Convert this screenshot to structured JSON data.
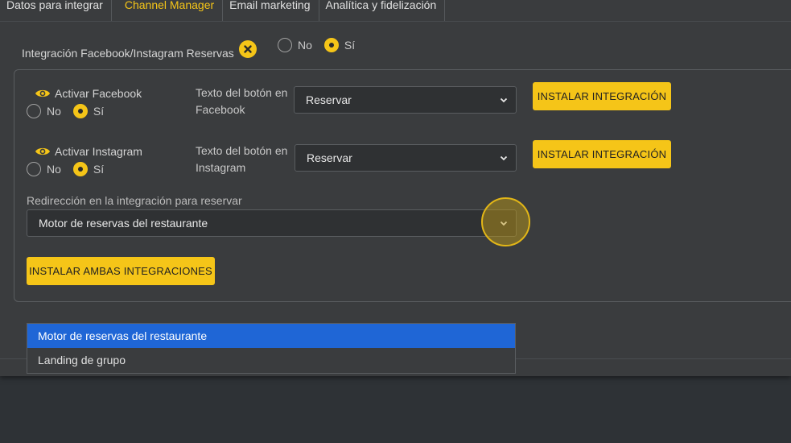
{
  "tabs": [
    {
      "label": "Datos para integrar",
      "active": false
    },
    {
      "label": "Channel Manager",
      "active": true
    },
    {
      "label": "Email marketing",
      "active": false
    },
    {
      "label": "Analítica y fidelización",
      "active": false
    }
  ],
  "integration": {
    "label": "Integración Facebook/Instagram Reservas",
    "radio_no": "No",
    "radio_si": "Sí",
    "selected": "si"
  },
  "facebook": {
    "activar_label": "Activar Facebook",
    "radio_no": "No",
    "radio_si": "Sí",
    "texto_label": "Texto del botón en Facebook",
    "select_value": "Reservar",
    "install_label": "INSTALAR INTEGRACIÓN"
  },
  "instagram": {
    "activar_label": "Activar Instagram",
    "radio_no": "No",
    "radio_si": "Sí",
    "texto_label": "Texto del botón en Instagram",
    "select_value": "Reservar",
    "install_label": "INSTALAR INTEGRACIÓN"
  },
  "redirect": {
    "label": "Redirección en la integración para reservar",
    "select_value": "Motor de reservas del restaurante",
    "options": [
      "Motor de reservas del restaurante",
      "Landing de grupo"
    ]
  },
  "install_both_label": "INSTALAR AMBAS INTEGRACIONES",
  "colors": {
    "accent": "#f5c518",
    "panel": "#3a3c3e",
    "background": "#2e3236",
    "selected_option": "#1f66d6"
  }
}
